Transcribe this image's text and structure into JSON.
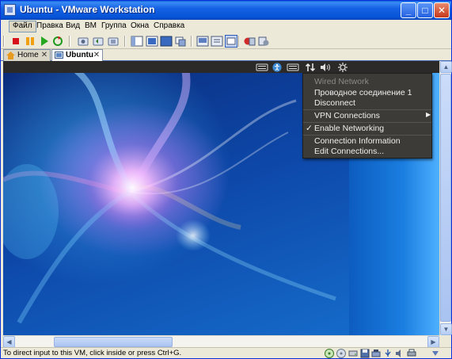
{
  "window": {
    "title": "Ubuntu - VMware Workstation"
  },
  "menubar": {
    "items": [
      "Файл",
      "Правка",
      "Вид",
      "ВМ",
      "Группа",
      "Окна",
      "Справка"
    ]
  },
  "tabs": [
    {
      "label": "Home",
      "active": false
    },
    {
      "label": "Ubuntu",
      "active": true
    }
  ],
  "network_menu": {
    "header": "Wired Network",
    "connection": "Проводное соединение 1",
    "disconnect": "Disconnect",
    "vpn": "VPN Connections",
    "enable_networking": "Enable Networking",
    "enable_networking_checked": true,
    "connection_info": "Connection Information",
    "edit_connections": "Edit Connections..."
  },
  "statusbar": {
    "text": "To direct input to this VM, click inside or press Ctrl+G."
  },
  "colors": {
    "titlebar": "#0553d6",
    "ubuntu_panel": "#2b2a28",
    "menu_bg": "#3c3b37",
    "menu_text": "#efefef"
  }
}
